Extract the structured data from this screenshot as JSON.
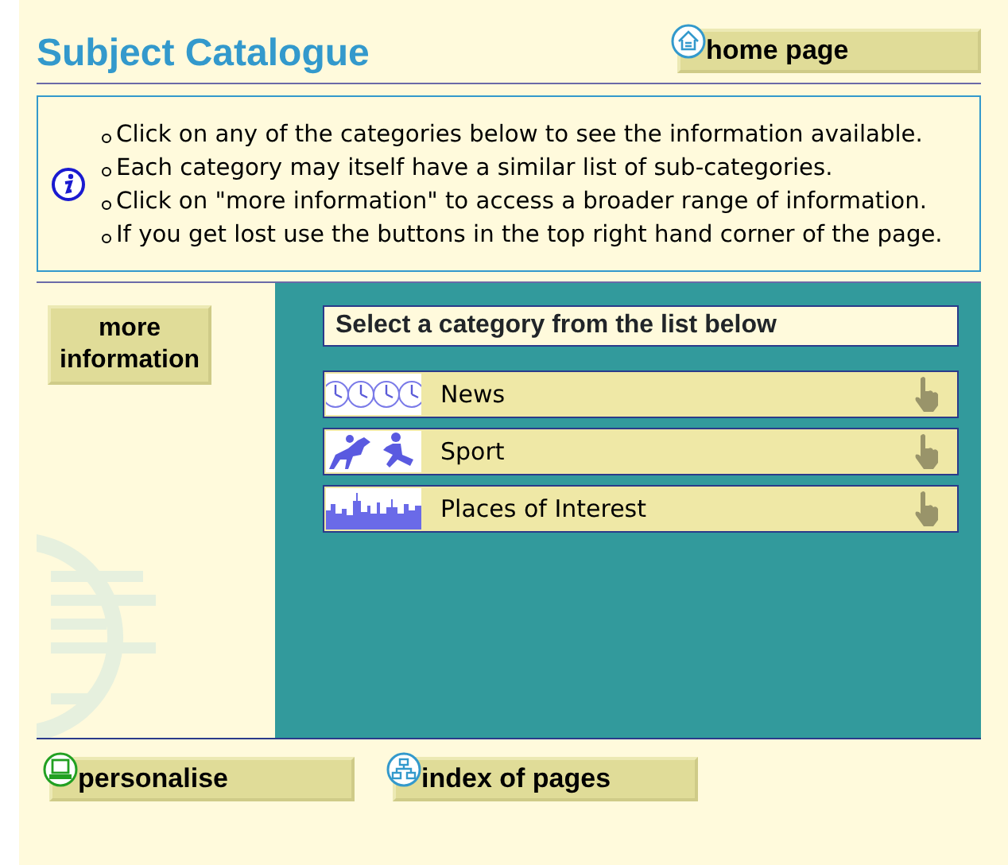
{
  "title": "Subject Catalogue",
  "home_button": "home page",
  "instructions": [
    "Click on any of the categories below to see the information available.",
    "Each category may itself have a similar list of sub-categories.",
    "Click on \"more information\" to access a broader range of information.",
    "If you get lost use the buttons in the top right hand corner of the page."
  ],
  "more_button": "more information",
  "category_heading": "Select a category from the list below",
  "categories": [
    {
      "label": "News",
      "kind": "clocks"
    },
    {
      "label": "Sport",
      "kind": "sport"
    },
    {
      "label": "Places of Interest",
      "kind": "city"
    }
  ],
  "bottom_buttons": [
    {
      "label": "personalise",
      "kind": "computer"
    },
    {
      "label": "index of pages",
      "kind": "sitemap"
    }
  ]
}
